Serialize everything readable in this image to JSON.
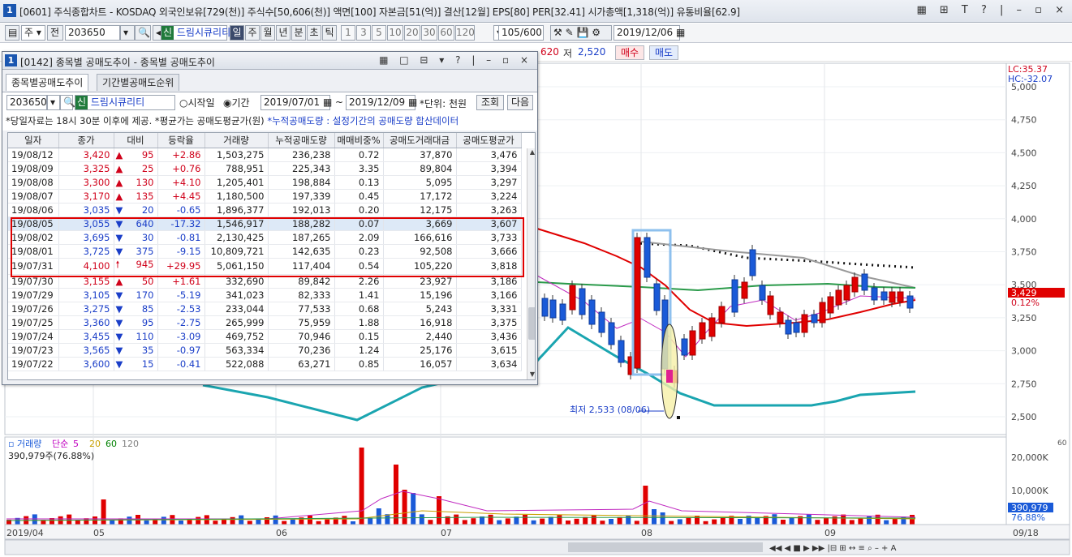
{
  "main_window": {
    "num": "1",
    "title": "[0601] 주식종합차트 - KOSDAQ 외국인보유[729(천)] 주식수[50,606(천)] 액면[100] 자본금[51(억)] 결산[12월] EPS[80] PER[32.41] 시가총액[1,318(억)] 유통비율[62.9]",
    "controls": "▦ ⊞ T ? | – ▫ ×"
  },
  "toolbar": {
    "mode": "주",
    "prev": "전",
    "code": "203650",
    "badge": "신",
    "name": "드림시큐리티",
    "periods": [
      "일",
      "주",
      "월",
      "년",
      "분",
      "초",
      "틱"
    ],
    "minutes": [
      "1",
      "3",
      "5",
      "10",
      "20",
      "30",
      "60",
      "120"
    ],
    "count": "105",
    "total": "/600",
    "date": "2019/12/06"
  },
  "info": {
    "low_label": "저",
    "low_value": "2,520",
    "left_value": "620",
    "buy": "매수",
    "sell": "매도"
  },
  "chart_data": {
    "type": "candlestick",
    "price_axis": [
      "5,000",
      "4,750",
      "4,500",
      "4,250",
      "4,000",
      "3,750",
      "3,500",
      "3,250",
      "3,000",
      "2,750",
      "2,500"
    ],
    "lc": "LC:35.37",
    "hc": "HC:-32.07",
    "current_price": "3,429",
    "current_pct": "0.12%",
    "low_annotation": "최저 2,533 (08/06)",
    "volume_legend": {
      "label": "거래량",
      "ma_label": "단순",
      "mas": [
        "5",
        "20",
        "60",
        "120"
      ],
      "ma_colors": [
        "#c000c0",
        "#c8a000",
        "#008000",
        "#808080"
      ]
    },
    "volume_value": "390,979주(76.88%)",
    "volume_axis": [
      "20,000K",
      "10,000K"
    ],
    "volume_current": "390,979",
    "volume_pct": "76.88%",
    "date_axis": [
      "2019/04",
      "05",
      "06",
      "07",
      "08",
      "09",
      "09/18"
    ],
    "volume_marker": "60"
  },
  "popup": {
    "num": "1",
    "title": "[0142] 종목별 공매도추이 - 종목별 공매도추이",
    "controls": "▦ □ ⊟ ▾ ? | – ▫ ×",
    "tabs": [
      "종목별공매도추이",
      "기간별공매도순위"
    ],
    "form": {
      "code": "203650",
      "badge": "신",
      "name": "드림시큐리티",
      "radio1": "시작일",
      "radio2": "기간",
      "start": "2019/07/01",
      "tilde": "~",
      "end": "2019/12/09",
      "unit": "*단위: 천원",
      "query": "조회",
      "next": "다음"
    },
    "note_black": "*당일자료는 18시 30분 이후에 제공. *평균가는 공매도평균가(원)",
    "note_blue": "*누적공매도량 : 설정기간의 공매도량 합산데이터",
    "columns": [
      "일자",
      "종가",
      "대비",
      "등락율",
      "거래량",
      "누적공매도량",
      "매매비중%",
      "공매도거래대금",
      "공매도평균가"
    ],
    "rows": [
      [
        "19/08/12",
        "3,420",
        "▲",
        "95",
        "+2.86",
        "1,503,275",
        "236,238",
        "0.72",
        "37,870",
        "3,476"
      ],
      [
        "19/08/09",
        "3,325",
        "▲",
        "25",
        "+0.76",
        "788,951",
        "225,343",
        "3.35",
        "89,804",
        "3,394"
      ],
      [
        "19/08/08",
        "3,300",
        "▲",
        "130",
        "+4.10",
        "1,205,401",
        "198,884",
        "0.13",
        "5,095",
        "3,297"
      ],
      [
        "19/08/07",
        "3,170",
        "▲",
        "135",
        "+4.45",
        "1,180,500",
        "197,339",
        "0.45",
        "17,172",
        "3,224"
      ],
      [
        "19/08/06",
        "3,035",
        "▼",
        "20",
        "-0.65",
        "1,896,377",
        "192,013",
        "0.20",
        "12,175",
        "3,263"
      ],
      [
        "19/08/05",
        "3,055",
        "▼",
        "640",
        "-17.32",
        "1,546,917",
        "188,282",
        "0.07",
        "3,669",
        "3,607"
      ],
      [
        "19/08/02",
        "3,695",
        "▼",
        "30",
        "-0.81",
        "2,130,425",
        "187,265",
        "2.09",
        "166,616",
        "3,733"
      ],
      [
        "19/08/01",
        "3,725",
        "▼",
        "375",
        "-9.15",
        "10,809,721",
        "142,635",
        "0.23",
        "92,508",
        "3,666"
      ],
      [
        "19/07/31",
        "4,100",
        "🠕",
        "945",
        "+29.95",
        "5,061,150",
        "117,404",
        "0.54",
        "105,220",
        "3,818"
      ],
      [
        "19/07/30",
        "3,155",
        "▲",
        "50",
        "+1.61",
        "332,690",
        "89,842",
        "2.26",
        "23,927",
        "3,186"
      ],
      [
        "19/07/29",
        "3,105",
        "▼",
        "170",
        "-5.19",
        "341,023",
        "82,333",
        "1.41",
        "15,196",
        "3,166"
      ],
      [
        "19/07/26",
        "3,275",
        "▼",
        "85",
        "-2.53",
        "233,044",
        "77,533",
        "0.68",
        "5,243",
        "3,331"
      ],
      [
        "19/07/25",
        "3,360",
        "▼",
        "95",
        "-2.75",
        "265,999",
        "75,959",
        "1.88",
        "16,918",
        "3,375"
      ],
      [
        "19/07/24",
        "3,455",
        "▼",
        "110",
        "-3.09",
        "469,752",
        "70,946",
        "0.15",
        "2,440",
        "3,436"
      ],
      [
        "19/07/23",
        "3,565",
        "▼",
        "35",
        "-0.97",
        "563,334",
        "70,236",
        "1.24",
        "25,176",
        "3,615"
      ],
      [
        "19/07/22",
        "3,600",
        "▼",
        "15",
        "-0.41",
        "522,088",
        "63,271",
        "0.85",
        "16,057",
        "3,634"
      ]
    ]
  }
}
